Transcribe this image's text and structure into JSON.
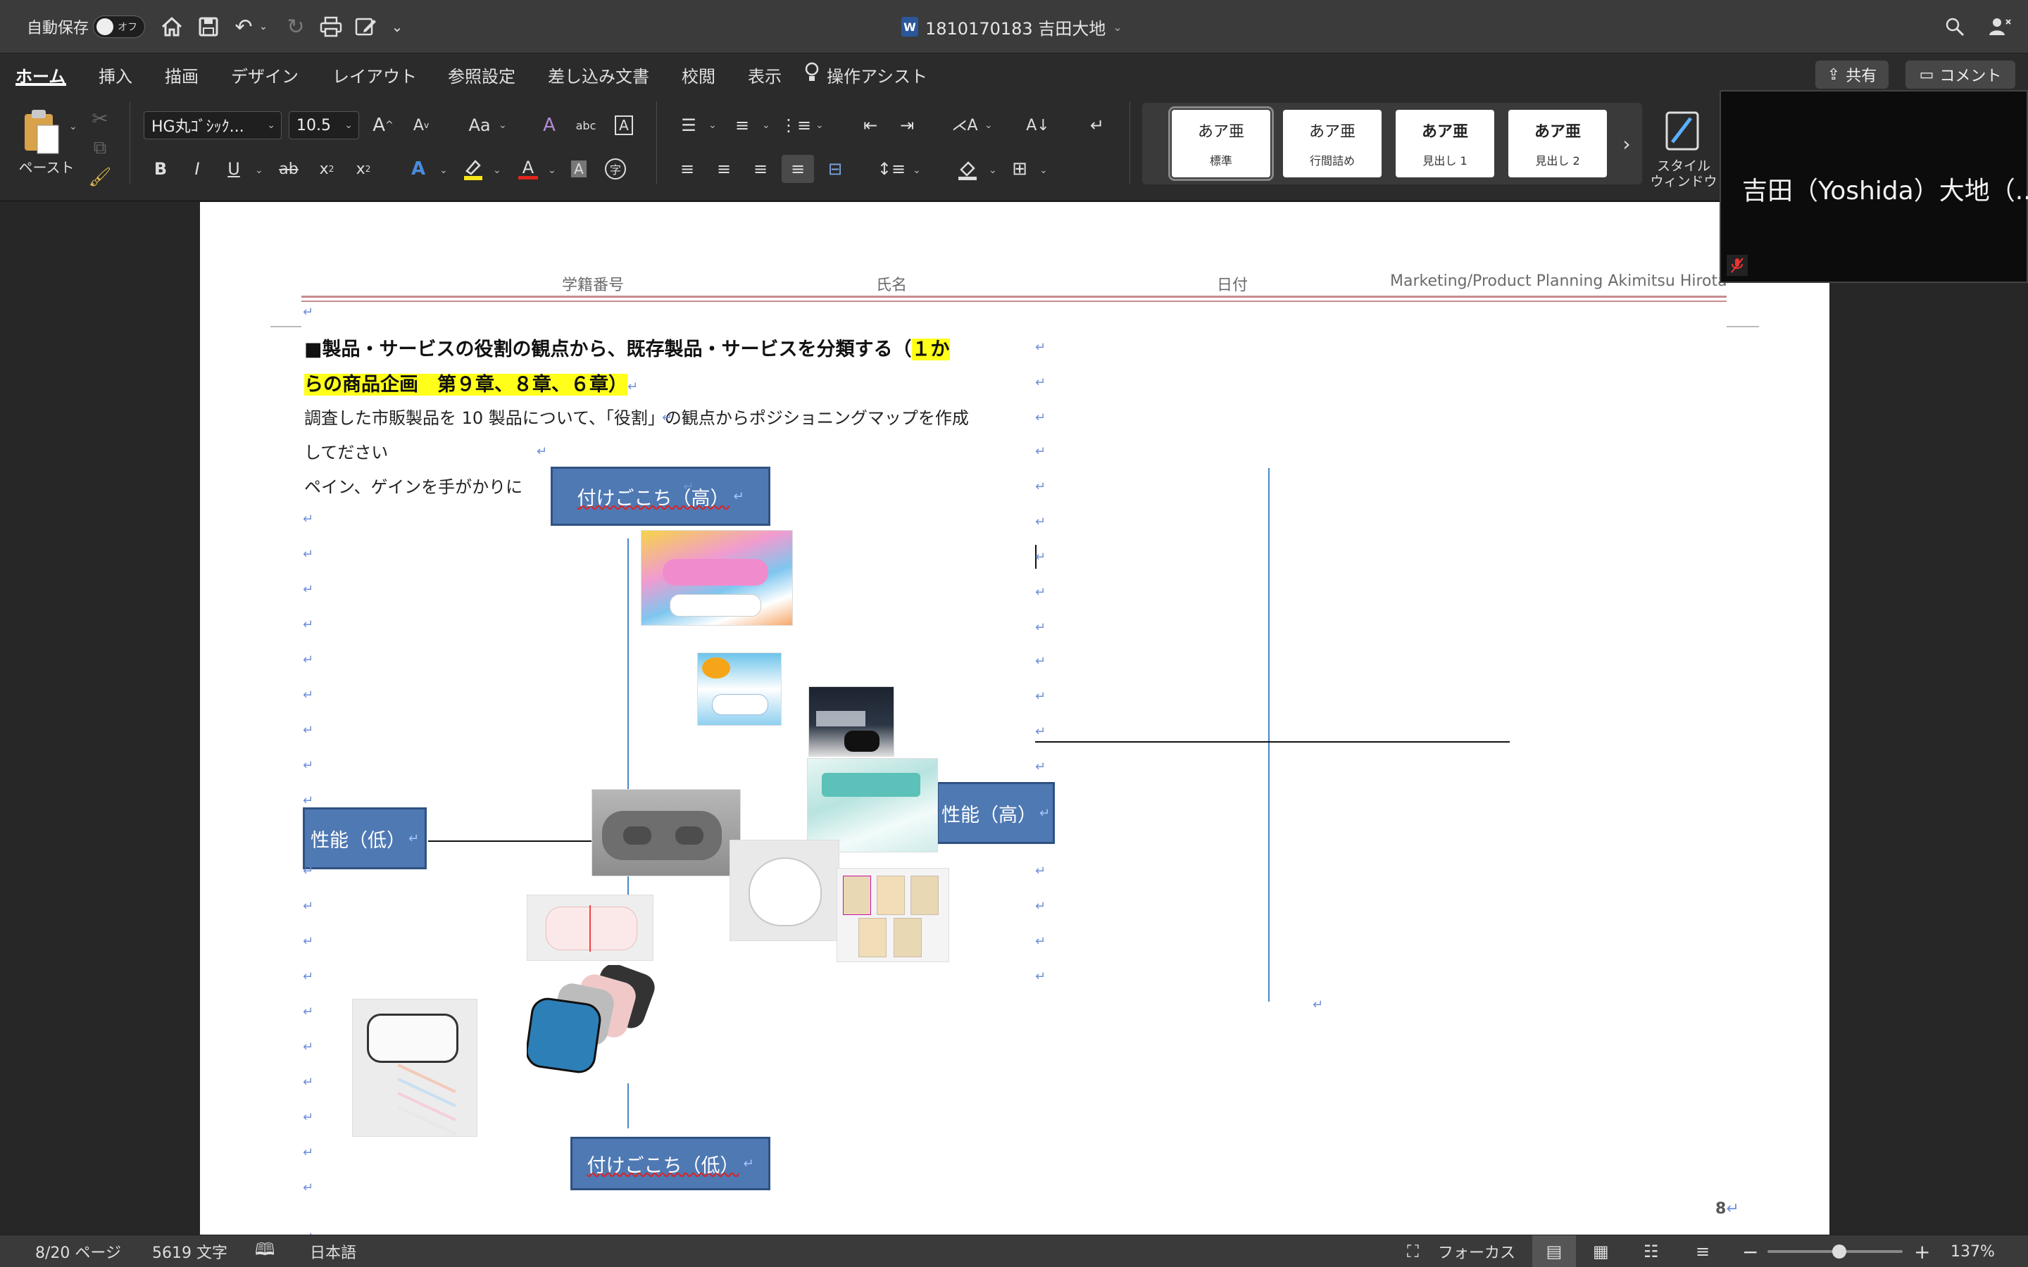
{
  "titlebar": {
    "autosave_label": "自動保存",
    "autosave_state": "オフ",
    "doc_title": "1810170183 吉田大地"
  },
  "ribbon_tabs": [
    "ホーム",
    "挿入",
    "描画",
    "デザイン",
    "レイアウト",
    "参照設定",
    "差し込み文書",
    "校閲",
    "表示"
  ],
  "assist_label": "操作アシスト",
  "share_label": "共有",
  "comment_label": "コメント",
  "ribbon": {
    "paste_label": "ペースト",
    "font_name": "HG丸ｺﾞｼｯｸ...",
    "font_size": "10.5",
    "styles": [
      {
        "sample": "あア亜",
        "name": "標準"
      },
      {
        "sample": "あア亜",
        "name": "行間詰め"
      },
      {
        "sample": "あア亜",
        "name": "見出し 1"
      },
      {
        "sample": "あア亜",
        "name": "見出し 2"
      }
    ],
    "style_window_label_1": "スタイル",
    "style_window_label_2": "ウィンドウ"
  },
  "video": {
    "name": "吉田（Yoshida）大地（..."
  },
  "document": {
    "header": {
      "student_no": "学籍番号",
      "name": "氏名",
      "date": "日付",
      "course": "Marketing/Product Planning Akimitsu Hirota"
    },
    "heading_part1": "■製品・サービスの役割の観点から、既存製品・サービスを分類する（",
    "heading_highlight_1": "１か",
    "heading_highlight_2": "らの商品企画　第９章、８章、６章）",
    "body_line1": "調査した市販製品を 10 製品について、「役割」の観点からポジショニングマップを作成",
    "body_line2": "してださい",
    "body_line3": "ペイン、ゲインを手がかりに",
    "axis_top": "付けごこち（高）",
    "axis_bottom": "付けごこち（低）",
    "axis_left": "性能（低）",
    "axis_right": "性能（高）",
    "page_number": "8"
  },
  "statusbar": {
    "page": "8/20 ページ",
    "words": "5619 文字",
    "language": "日本語",
    "focus": "フォーカス",
    "zoom": "137%"
  }
}
